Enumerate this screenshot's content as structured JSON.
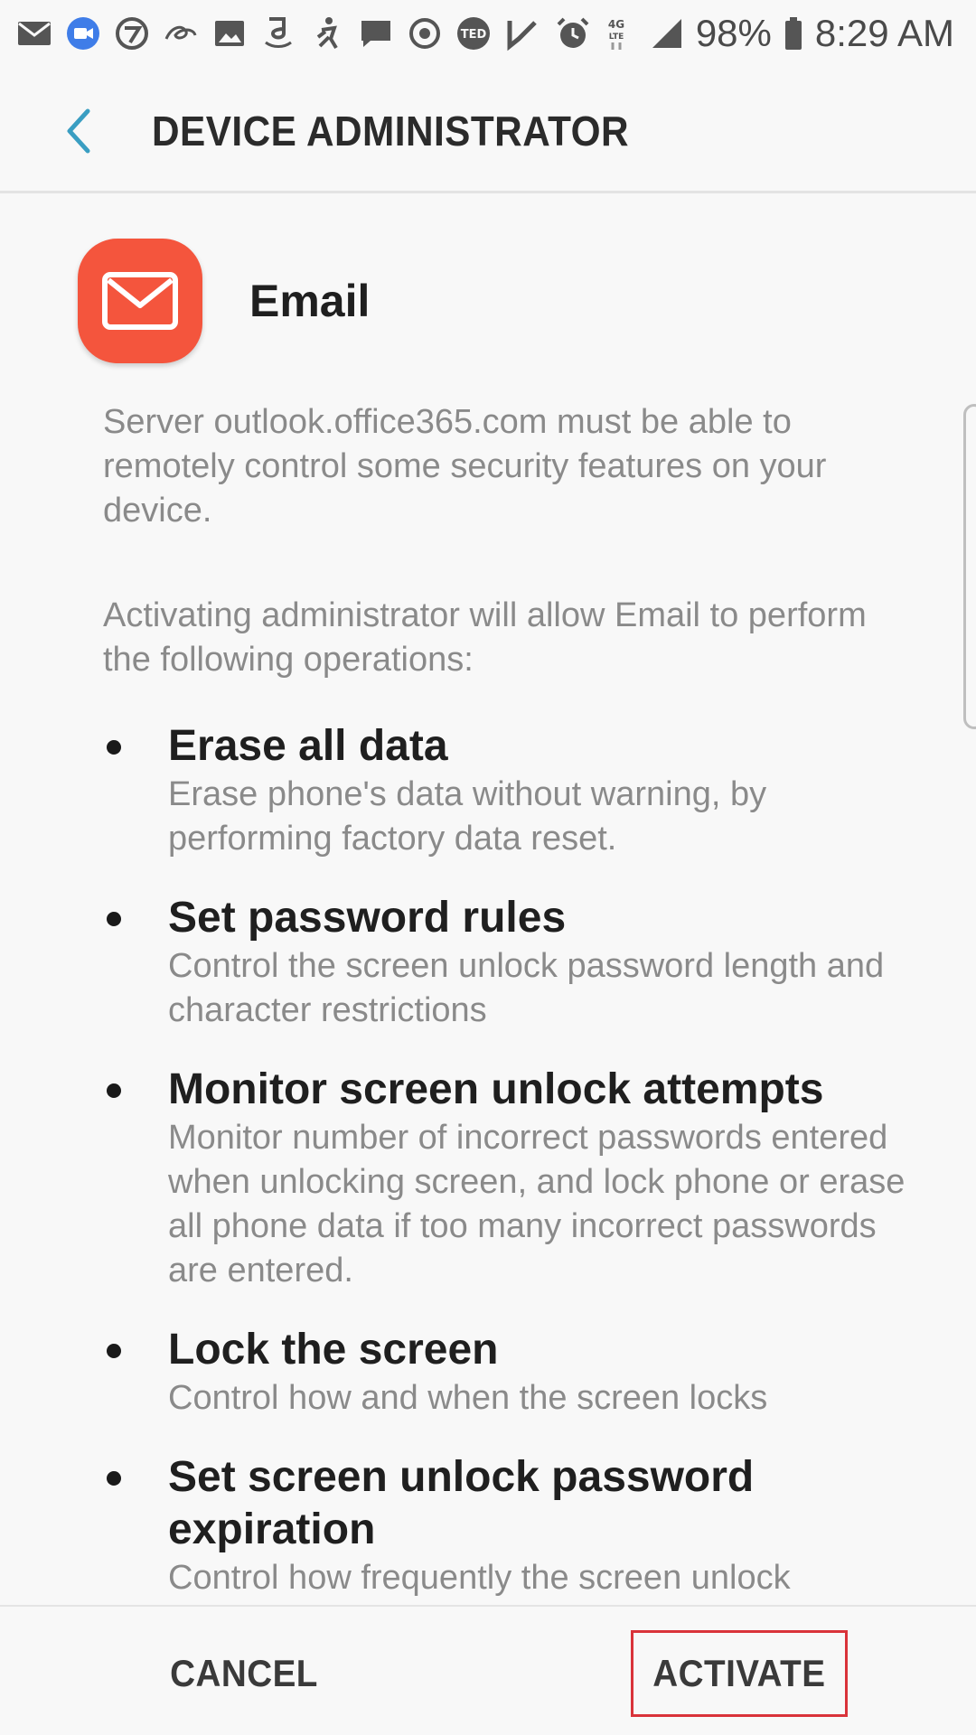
{
  "status_bar": {
    "battery": "98%",
    "time": "8:29 AM",
    "network": "4G LTE",
    "left_icons": [
      "gmail-icon",
      "duo-icon",
      "sports-icon",
      "alibaba-icon",
      "gallery-icon",
      "amazon-icon",
      "figure-icon",
      "messages-icon",
      "sync-icon",
      "ted-icon",
      "check-icon"
    ],
    "right_icons": [
      "alarm-icon",
      "lte-icon",
      "signal-icon",
      "battery-icon"
    ]
  },
  "header": {
    "title": "DEVICE ADMINISTRATOR",
    "back_icon": "chevron-left-icon",
    "accent_color": "#3a9ec2"
  },
  "app": {
    "name": "Email",
    "icon": "mail-icon",
    "icon_color": "#f4553d"
  },
  "description": "Server outlook.office365.com must be able to remotely control some security features on your device.",
  "intro": "Activating administrator will allow Email to perform the following operations:",
  "permissions": [
    {
      "title": "Erase all data",
      "desc": "Erase phone's data without warning, by performing factory data reset."
    },
    {
      "title": "Set password rules",
      "desc": "Control the screen unlock password length and character restrictions"
    },
    {
      "title": "Monitor screen unlock attempts",
      "desc": "Monitor number of incorrect passwords entered when unlocking screen, and lock phone or erase all phone data if too many incorrect passwords are entered."
    },
    {
      "title": "Lock the screen",
      "desc": "Control how and when the screen locks"
    },
    {
      "title": "Set screen unlock password expiration",
      "desc": "Control how frequently the screen unlock"
    }
  ],
  "buttons": {
    "cancel": "CANCEL",
    "activate": "ACTIVATE",
    "highlight_color": "#d9333a"
  }
}
